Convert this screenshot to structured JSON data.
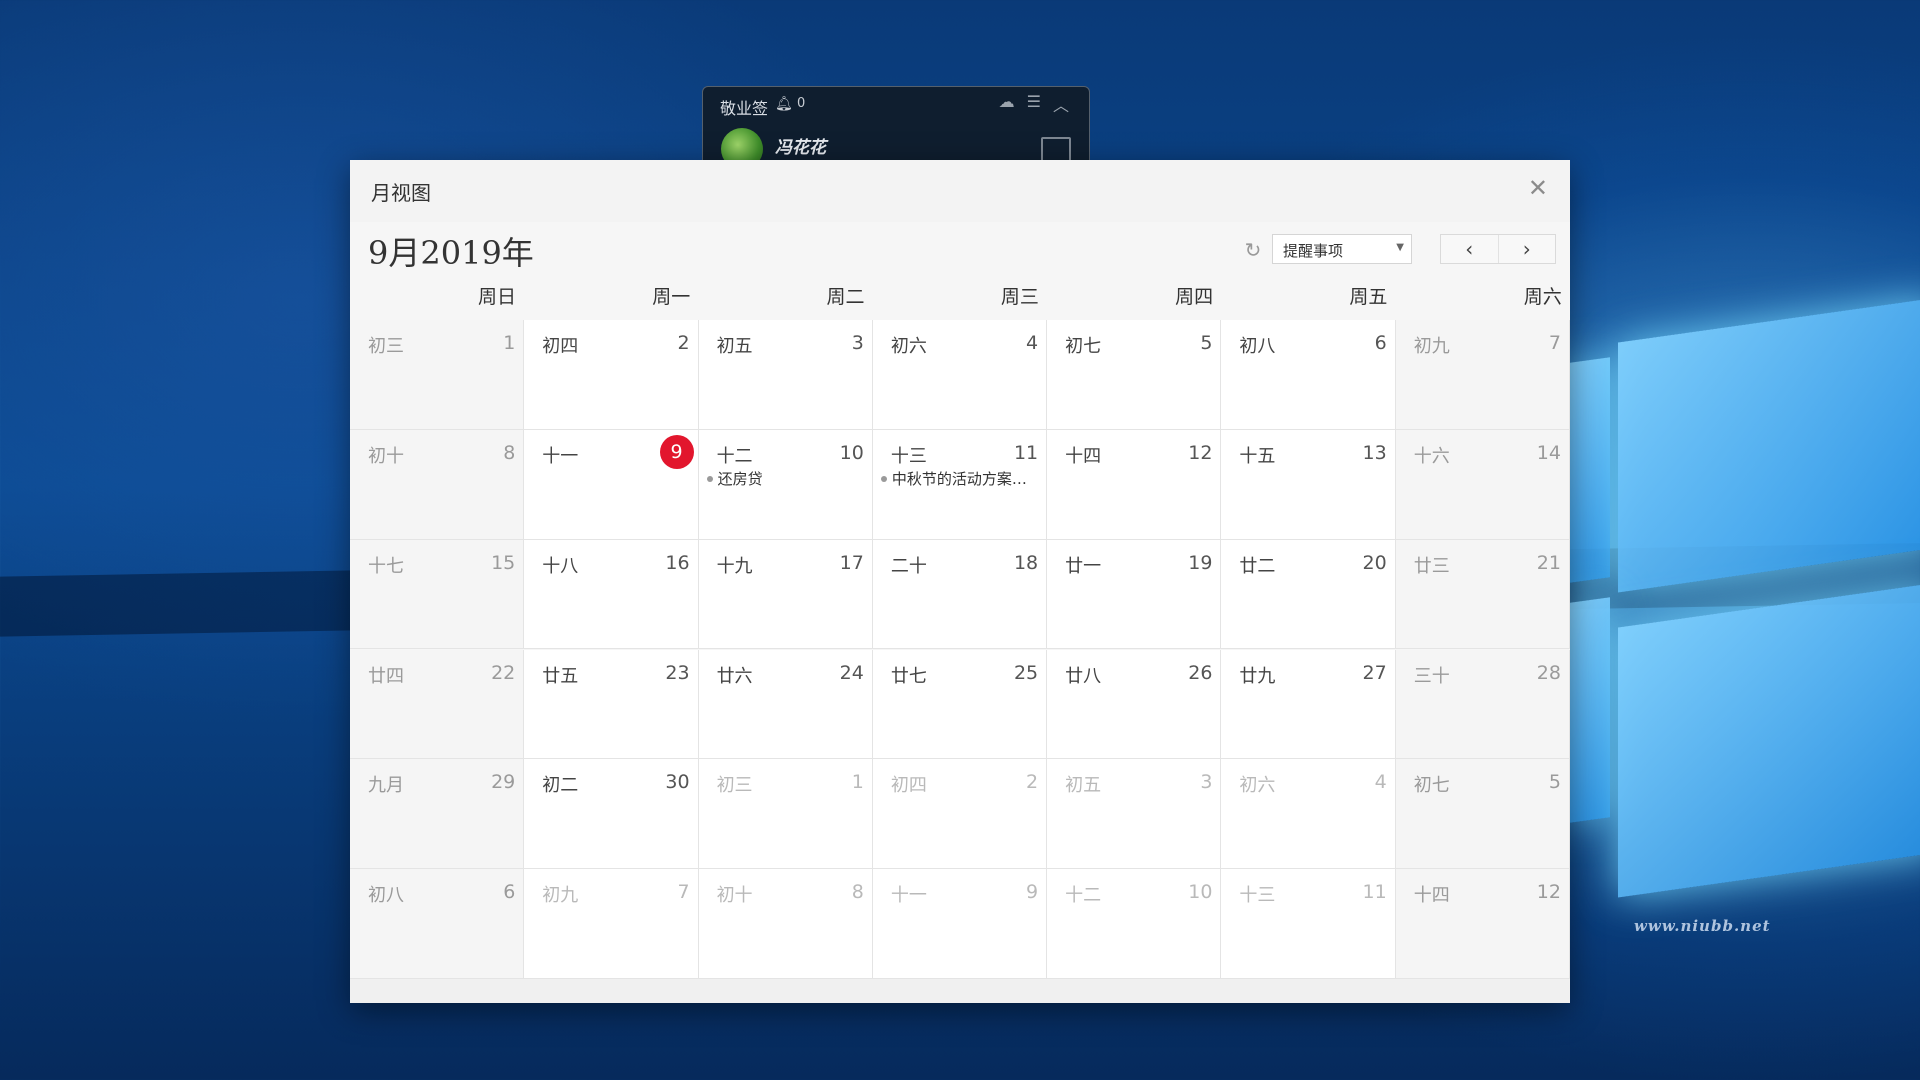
{
  "desktop": {
    "watermark": "www.niubb.net"
  },
  "widget": {
    "title": "敬业签",
    "bell_icon": "bell-icon",
    "notification_count": "0",
    "user_name": "冯花花"
  },
  "window": {
    "title": "月视图",
    "month_label": "9月2019年",
    "filter_value": "提醒事项",
    "today_color": "#e2162d"
  },
  "weekdays": [
    "周日",
    "周一",
    "周二",
    "周三",
    "周四",
    "周五",
    "周六"
  ],
  "weeks": [
    [
      {
        "lunar": "初三",
        "day": "1",
        "dim": false
      },
      {
        "lunar": "初四",
        "day": "2",
        "dim": false
      },
      {
        "lunar": "初五",
        "day": "3",
        "dim": false
      },
      {
        "lunar": "初六",
        "day": "4",
        "dim": false
      },
      {
        "lunar": "初七",
        "day": "5",
        "dim": false
      },
      {
        "lunar": "初八",
        "day": "6",
        "dim": false
      },
      {
        "lunar": "初九",
        "day": "7",
        "dim": false
      }
    ],
    [
      {
        "lunar": "初十",
        "day": "8",
        "dim": false
      },
      {
        "lunar": "十一",
        "day": "9",
        "dim": false,
        "today": true
      },
      {
        "lunar": "十二",
        "day": "10",
        "dim": false,
        "event": "还房贷"
      },
      {
        "lunar": "十三",
        "day": "11",
        "dim": false,
        "event": "中秋节的活动方案…"
      },
      {
        "lunar": "十四",
        "day": "12",
        "dim": false
      },
      {
        "lunar": "十五",
        "day": "13",
        "dim": false
      },
      {
        "lunar": "十六",
        "day": "14",
        "dim": false
      }
    ],
    [
      {
        "lunar": "十七",
        "day": "15",
        "dim": false
      },
      {
        "lunar": "十八",
        "day": "16",
        "dim": false
      },
      {
        "lunar": "十九",
        "day": "17",
        "dim": false
      },
      {
        "lunar": "二十",
        "day": "18",
        "dim": false
      },
      {
        "lunar": "廿一",
        "day": "19",
        "dim": false
      },
      {
        "lunar": "廿二",
        "day": "20",
        "dim": false
      },
      {
        "lunar": "廿三",
        "day": "21",
        "dim": false
      }
    ],
    [
      {
        "lunar": "廿四",
        "day": "22",
        "dim": false
      },
      {
        "lunar": "廿五",
        "day": "23",
        "dim": false
      },
      {
        "lunar": "廿六",
        "day": "24",
        "dim": false
      },
      {
        "lunar": "廿七",
        "day": "25",
        "dim": false
      },
      {
        "lunar": "廿八",
        "day": "26",
        "dim": false
      },
      {
        "lunar": "廿九",
        "day": "27",
        "dim": false
      },
      {
        "lunar": "三十",
        "day": "28",
        "dim": false
      }
    ],
    [
      {
        "lunar": "九月",
        "day": "29",
        "dim": false
      },
      {
        "lunar": "初二",
        "day": "30",
        "dim": false
      },
      {
        "lunar": "初三",
        "day": "1",
        "dim": true
      },
      {
        "lunar": "初四",
        "day": "2",
        "dim": true
      },
      {
        "lunar": "初五",
        "day": "3",
        "dim": true
      },
      {
        "lunar": "初六",
        "day": "4",
        "dim": true
      },
      {
        "lunar": "初七",
        "day": "5",
        "dim": true
      }
    ],
    [
      {
        "lunar": "初八",
        "day": "6",
        "dim": true
      },
      {
        "lunar": "初九",
        "day": "7",
        "dim": true
      },
      {
        "lunar": "初十",
        "day": "8",
        "dim": true
      },
      {
        "lunar": "十一",
        "day": "9",
        "dim": true
      },
      {
        "lunar": "十二",
        "day": "10",
        "dim": true
      },
      {
        "lunar": "十三",
        "day": "11",
        "dim": true
      },
      {
        "lunar": "十四",
        "day": "12",
        "dim": true
      }
    ]
  ]
}
